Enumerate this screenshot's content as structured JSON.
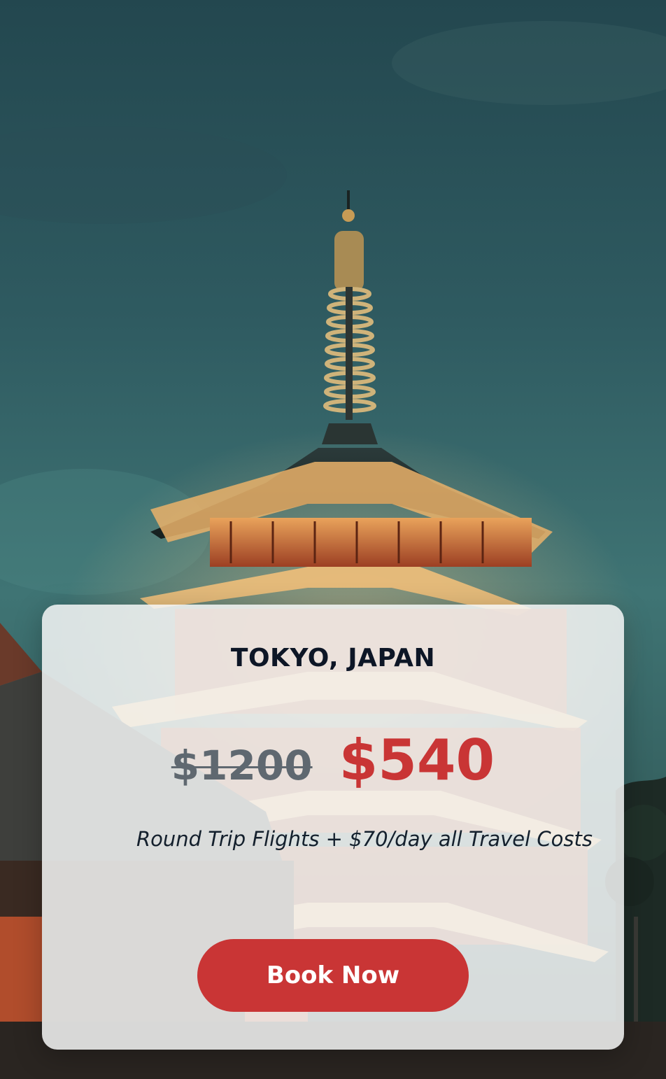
{
  "destination": {
    "title": "TOKYO, JAPAN"
  },
  "pricing": {
    "original_price": "$1200",
    "sale_price": "$540"
  },
  "offer": {
    "description": "Round Trip Flights + $70/day all Travel Costs"
  },
  "actions": {
    "book_label": "Book Now"
  },
  "colors": {
    "accent": "#c93535",
    "title_text": "#0d1626",
    "old_price_text": "#5f6870",
    "sky_top": "#23474f",
    "pagoda_wood": "#c4673a",
    "pagoda_light": "#f3c27a"
  },
  "background": {
    "image_subject": "pagoda-photo"
  }
}
